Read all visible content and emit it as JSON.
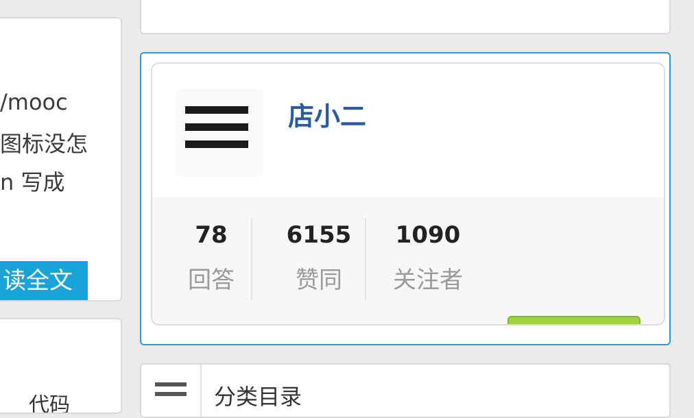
{
  "left_article": {
    "lines": [
      "/mooc",
      "图标没怎",
      "n 写成"
    ],
    "read_more": "读全文"
  },
  "left_card2": {
    "fragment": "代码"
  },
  "profile": {
    "name": "店小二",
    "avatar_icon": "menu-icon",
    "stats": [
      {
        "value": "78",
        "label": "回答"
      },
      {
        "value": "6155",
        "label": "赞同"
      },
      {
        "value": "1090",
        "label": "关注者"
      }
    ],
    "colors": {
      "accent_border": "#2b9bd1",
      "name": "#2a5aa0",
      "follow_button": "#9ed23f"
    }
  },
  "category": {
    "title": "分类目录",
    "icon": "list-icon"
  }
}
